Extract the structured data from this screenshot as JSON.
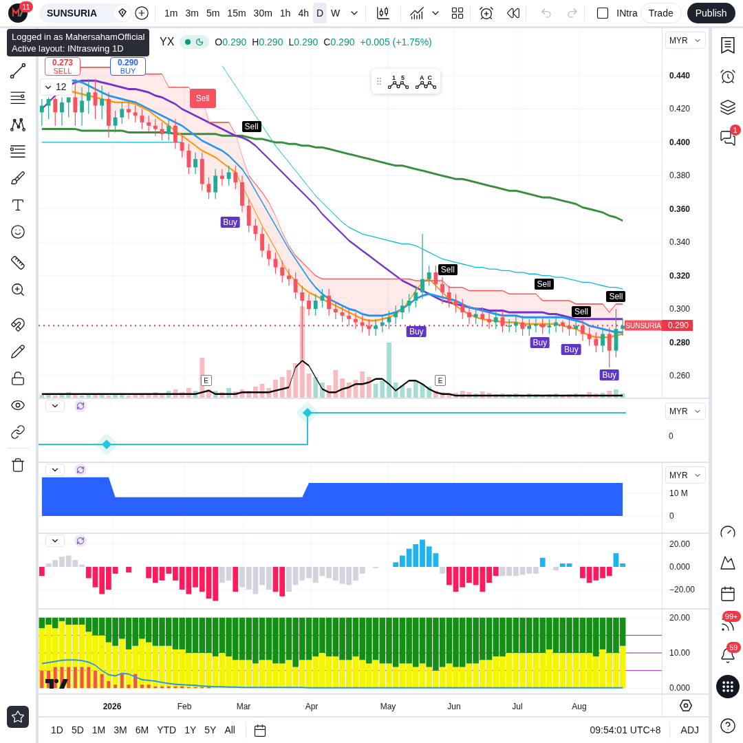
{
  "toolbar": {
    "avatar_badge": "11",
    "symbol": "SUNSURIA",
    "intervals": [
      {
        "label": "1m",
        "selected": false
      },
      {
        "label": "3m",
        "selected": false
      },
      {
        "label": "5m",
        "selected": false
      },
      {
        "label": "15m",
        "selected": false
      },
      {
        "label": "30m",
        "selected": false
      },
      {
        "label": "1h",
        "selected": false
      },
      {
        "label": "4h",
        "selected": false
      },
      {
        "label": "D",
        "selected": true
      },
      {
        "label": "W",
        "selected": false
      }
    ],
    "layout_name": "INtra",
    "trade_button": "Trade",
    "publish_button": "Publish",
    "undo_disabled": true,
    "redo_disabled": true
  },
  "tooltip": {
    "lines": [
      "Logged in as MahersahamOfficial",
      "Active layout: INtraswing 1D"
    ]
  },
  "legend": {
    "title": "YX",
    "values": [
      {
        "key": "O",
        "value": "0.290"
      },
      {
        "key": "H",
        "value": "0.290"
      },
      {
        "key": "L",
        "value": "0.290"
      },
      {
        "key": "C",
        "value": "0.290"
      }
    ],
    "change": "+0.005 (+1.75%)"
  },
  "order_buttons": [
    {
      "kind": "sell",
      "price": "0.273",
      "label": "SELL"
    },
    {
      "kind": "buy",
      "price": "0.290",
      "label": "BUY"
    }
  ],
  "indicator_toggle": {
    "count": "12"
  },
  "wave_tools": [
    {
      "labels": [
        "1",
        "5"
      ]
    },
    {
      "labels": [
        "A",
        "C"
      ]
    }
  ],
  "signals": [
    {
      "kind": "alert",
      "label": "Sell"
    },
    {
      "kind": "sell",
      "label": "Sell"
    },
    {
      "kind": "buy",
      "label": "Buy"
    },
    {
      "kind": "buy",
      "label": "Buy"
    },
    {
      "kind": "sell",
      "label": "Sell"
    },
    {
      "kind": "sell",
      "label": "Sell"
    },
    {
      "kind": "buy",
      "label": "Buy"
    },
    {
      "kind": "sell",
      "label": "Sell"
    },
    {
      "kind": "buy",
      "label": "Buy"
    },
    {
      "kind": "sell",
      "label": "Sell"
    },
    {
      "kind": "buy",
      "label": "Buy"
    },
    {
      "kind": "earnings",
      "label": "E"
    },
    {
      "kind": "earnings",
      "label": "E"
    }
  ],
  "price_marker": {
    "symbol": "SUNSURIA",
    "price": "0.290"
  },
  "panes": [
    {
      "kind": "price",
      "currency": "MYR",
      "chart_data": {
        "type": "candlestick",
        "grid": true,
        "ylim": [
          0.2468,
          0.4685
        ],
        "yticks": [
          {
            "value": 0.44,
            "label": "0.440"
          },
          {
            "value": 0.42,
            "label": "0.420"
          },
          {
            "value": 0.4,
            "label": "0.400"
          },
          {
            "value": 0.38,
            "label": "0.380"
          },
          {
            "value": 0.36,
            "label": "0.360"
          },
          {
            "value": 0.34,
            "label": "0.340"
          },
          {
            "value": 0.32,
            "label": "0.320"
          },
          {
            "value": 0.3,
            "label": "0.300"
          },
          {
            "value": 0.28,
            "label": "0.280"
          },
          {
            "value": 0.26,
            "label": "0.260"
          }
        ],
        "categories": [
          null,
          null,
          null,
          null,
          null,
          null,
          null,
          null,
          null,
          null,
          null,
          null,
          null,
          null,
          null,
          null,
          null,
          null,
          null,
          null,
          null,
          null,
          null,
          null,
          null,
          null,
          null,
          null,
          null,
          null,
          null,
          null,
          null,
          null,
          null,
          null,
          null,
          null,
          null,
          null,
          null,
          null,
          null,
          null,
          null,
          null,
          null,
          null,
          null,
          null,
          null,
          null,
          null,
          null,
          null,
          null,
          null,
          null,
          null,
          null,
          null,
          null,
          null,
          null,
          null,
          null,
          null,
          null,
          null,
          null,
          null,
          null,
          null,
          null,
          null,
          null,
          null,
          null,
          null,
          null,
          null,
          null,
          null,
          null,
          null,
          null,
          null,
          null
        ],
        "ohlc": [
          [
            0.418,
            0.426,
            0.41,
            0.422
          ],
          [
            0.422,
            0.427,
            0.414,
            0.426
          ],
          [
            0.426,
            0.427,
            0.41,
            0.418
          ],
          [
            0.418,
            0.427,
            0.41,
            0.424
          ],
          [
            0.424,
            0.427,
            0.415,
            0.427
          ],
          [
            0.427,
            0.438,
            0.41,
            0.418
          ],
          [
            0.418,
            0.433,
            0.41,
            0.425
          ],
          [
            0.425,
            0.438,
            0.417,
            0.43
          ],
          [
            0.43,
            0.438,
            0.414,
            0.422
          ],
          [
            0.422,
            0.434,
            0.414,
            0.426
          ],
          [
            0.426,
            0.43,
            0.403,
            0.41
          ],
          [
            0.41,
            0.419,
            0.406,
            0.415
          ],
          [
            0.415,
            0.424,
            0.411,
            0.42
          ],
          [
            0.42,
            0.424,
            0.414,
            0.418
          ],
          [
            0.418,
            0.422,
            0.412,
            0.416
          ],
          [
            0.416,
            0.42,
            0.408,
            0.412
          ],
          [
            0.412,
            0.416,
            0.406,
            0.41
          ],
          [
            0.41,
            0.414,
            0.404,
            0.408
          ],
          [
            0.408,
            0.412,
            0.401,
            0.405
          ],
          [
            0.405,
            0.414,
            0.401,
            0.41
          ],
          [
            0.41,
            0.414,
            0.396,
            0.4
          ],
          [
            0.4,
            0.404,
            0.391,
            0.395
          ],
          [
            0.395,
            0.399,
            0.381,
            0.385
          ],
          [
            0.385,
            0.394,
            0.381,
            0.39
          ],
          [
            0.39,
            0.394,
            0.371,
            0.375
          ],
          [
            0.375,
            0.379,
            0.366,
            0.37
          ],
          [
            0.37,
            0.384,
            0.366,
            0.38
          ],
          [
            0.38,
            0.384,
            0.374,
            0.378
          ],
          [
            0.378,
            0.386,
            0.374,
            0.382
          ],
          [
            0.382,
            0.386,
            0.372,
            0.376
          ],
          [
            0.376,
            0.38,
            0.358,
            0.362
          ],
          [
            0.362,
            0.366,
            0.346,
            0.35
          ],
          [
            0.35,
            0.354,
            0.341,
            0.345
          ],
          [
            0.345,
            0.349,
            0.331,
            0.335
          ],
          [
            0.335,
            0.339,
            0.326,
            0.33
          ],
          [
            0.33,
            0.334,
            0.321,
            0.325
          ],
          [
            0.325,
            0.329,
            0.316,
            0.32
          ],
          [
            0.32,
            0.324,
            0.314,
            0.318
          ],
          [
            0.318,
            0.322,
            0.306,
            0.31
          ],
          [
            0.31,
            0.314,
            0.27,
            0.305
          ],
          [
            0.305,
            0.309,
            0.296,
            0.3
          ],
          [
            0.3,
            0.309,
            0.296,
            0.305
          ],
          [
            0.305,
            0.312,
            0.301,
            0.308
          ],
          [
            0.308,
            0.312,
            0.296,
            0.3
          ],
          [
            0.3,
            0.304,
            0.294,
            0.298
          ],
          [
            0.298,
            0.302,
            0.292,
            0.296
          ],
          [
            0.296,
            0.3,
            0.29,
            0.294
          ],
          [
            0.294,
            0.298,
            0.288,
            0.292
          ],
          [
            0.292,
            0.296,
            0.286,
            0.29
          ],
          [
            0.29,
            0.294,
            0.284,
            0.288
          ],
          [
            0.288,
            0.294,
            0.284,
            0.29
          ],
          [
            0.29,
            0.296,
            0.286,
            0.292
          ],
          [
            0.292,
            0.299,
            0.288,
            0.295
          ],
          [
            0.295,
            0.302,
            0.291,
            0.298
          ],
          [
            0.298,
            0.306,
            0.294,
            0.302
          ],
          [
            0.302,
            0.309,
            0.298,
            0.305
          ],
          [
            0.305,
            0.314,
            0.301,
            0.31
          ],
          [
            0.31,
            0.345,
            0.306,
            0.318
          ],
          [
            0.318,
            0.326,
            0.314,
            0.322
          ],
          [
            0.322,
            0.326,
            0.311,
            0.315
          ],
          [
            0.315,
            0.319,
            0.303,
            0.31
          ],
          [
            0.31,
            0.314,
            0.301,
            0.305
          ],
          [
            0.305,
            0.309,
            0.298,
            0.302
          ],
          [
            0.302,
            0.306,
            0.294,
            0.298
          ],
          [
            0.298,
            0.302,
            0.291,
            0.295
          ],
          [
            0.295,
            0.301,
            0.291,
            0.297
          ],
          [
            0.297,
            0.301,
            0.29,
            0.294
          ],
          [
            0.294,
            0.298,
            0.288,
            0.292
          ],
          [
            0.292,
            0.299,
            0.288,
            0.295
          ],
          [
            0.295,
            0.299,
            0.286,
            0.29
          ],
          [
            0.29,
            0.294,
            0.286,
            0.29
          ],
          [
            0.29,
            0.296,
            0.286,
            0.292
          ],
          [
            0.292,
            0.296,
            0.284,
            0.288
          ],
          [
            0.288,
            0.294,
            0.284,
            0.29
          ],
          [
            0.29,
            0.295,
            0.286,
            0.291
          ],
          [
            0.291,
            0.295,
            0.285,
            0.289
          ],
          [
            0.289,
            0.294,
            0.285,
            0.29
          ],
          [
            0.29,
            0.296,
            0.286,
            0.292
          ],
          [
            0.292,
            0.293,
            0.286,
            0.29
          ],
          [
            0.29,
            0.294,
            0.284,
            0.288
          ],
          [
            0.288,
            0.294,
            0.284,
            0.29
          ],
          [
            0.29,
            0.294,
            0.281,
            0.285
          ],
          [
            0.285,
            0.289,
            0.278,
            0.282
          ],
          [
            0.282,
            0.286,
            0.274,
            0.278
          ],
          [
            0.278,
            0.289,
            0.274,
            0.285
          ],
          [
            0.285,
            0.289,
            0.265,
            0.275
          ],
          [
            0.275,
            0.3,
            0.271,
            0.288
          ],
          [
            0.288,
            0.294,
            0.284,
            0.29
          ]
        ]
      }
    },
    {
      "kind": "steps",
      "currency": "MYR",
      "tick": "0",
      "header_controls": true
    },
    {
      "kind": "area",
      "currency": "MYR",
      "header_controls": true,
      "chart_data": {
        "type": "area",
        "grid": true,
        "ylim": [
          -7.3,
          23.3
        ],
        "yticks": [
          {
            "value": 10,
            "label": "10 M"
          },
          {
            "value": 0,
            "label": "0"
          }
        ],
        "categories": [
          null,
          null,
          null,
          null,
          null,
          null,
          null,
          null,
          null,
          null,
          null,
          null,
          null,
          null,
          null,
          null,
          null,
          null,
          null,
          null,
          null,
          null,
          null,
          null,
          null,
          null,
          null,
          null,
          null,
          null,
          null,
          null,
          null,
          null,
          null,
          null,
          null,
          null,
          null,
          null,
          null,
          null,
          null,
          null,
          null,
          null,
          null,
          null,
          null,
          null,
          null,
          null,
          null,
          null,
          null,
          null,
          null,
          null,
          null,
          null,
          null,
          null,
          null,
          null,
          null,
          null,
          null,
          null,
          null,
          null,
          null,
          null,
          null,
          null,
          null,
          null,
          null,
          null,
          null,
          null,
          null,
          null,
          null,
          null,
          null,
          null,
          null,
          null
        ],
        "series": [
          {
            "color": "#2962ff",
            "values": [
              17,
              17,
              17,
              17,
              17,
              17,
              17,
              17,
              17,
              17,
              17,
              8.2,
              8.2,
              8.2,
              8.2,
              8.2,
              8.2,
              8.2,
              8.2,
              8.2,
              8.2,
              8.2,
              8.2,
              8.2,
              8.2,
              8.2,
              8.2,
              8.2,
              8.2,
              8.2,
              8.2,
              8.2,
              8.2,
              8.2,
              8.2,
              8.2,
              8.2,
              8.2,
              8.2,
              8.2,
              14.5,
              14.5,
              14.5,
              14.5,
              14.5,
              14.5,
              14.5,
              14.5,
              14.5,
              14.5,
              14.5,
              14.5,
              14.5,
              14.5,
              14.5,
              14.5,
              14.5,
              14.5,
              14.5,
              14.5,
              14.5,
              14.5,
              14.5,
              14.5,
              14.5,
              14.5,
              14.5,
              14.5,
              14.5,
              14.5,
              14.5,
              14.5,
              14.5,
              14.5,
              14.5,
              14.5,
              14.5,
              14.5,
              14.5,
              14.5,
              14.5,
              14.5,
              14.5,
              14.5,
              14.5,
              14.5,
              14.5,
              14.5
            ]
          }
        ]
      }
    },
    {
      "kind": "histogram",
      "header_controls": true,
      "chart_data": {
        "type": "bar",
        "grid": true,
        "ylim": [
          -36.4,
          29.1
        ],
        "yticks": [
          {
            "value": 20,
            "label": "20.00"
          },
          {
            "value": 0,
            "label": "0.000"
          },
          {
            "value": -20,
            "label": "−20.00"
          }
        ],
        "categories": [
          null,
          null,
          null,
          null,
          null,
          null,
          null,
          null,
          null,
          null,
          null,
          null,
          null,
          null,
          null,
          null,
          null,
          null,
          null,
          null,
          null,
          null,
          null,
          null,
          null,
          null,
          null,
          null,
          null,
          null,
          null,
          null,
          null,
          null,
          null,
          null,
          null,
          null,
          null,
          null,
          null,
          null,
          null,
          null,
          null,
          null,
          null,
          null,
          null,
          null,
          null,
          null,
          null,
          null,
          null,
          null,
          null,
          null,
          null,
          null,
          null,
          null,
          null,
          null,
          null,
          null,
          null,
          null,
          null,
          null,
          null,
          null,
          null,
          null,
          null,
          null,
          null,
          null,
          null,
          null,
          null,
          null,
          null,
          null,
          null,
          null,
          null,
          null
        ],
        "series": [
          {
            "color": "#d1d4dc",
            "values": [
              null,
              3,
              6,
              9,
              10,
              6,
              2,
              null,
              null,
              null,
              null,
              null,
              null,
              null,
              null,
              null,
              null,
              null,
              null,
              null,
              null,
              null,
              null,
              null,
              null,
              null,
              null,
              -14,
              -12,
              null,
              -18,
              -20,
              -24,
              -16,
              -20,
              null,
              null,
              -22,
              -16,
              -12,
              -10,
              -14,
              -8,
              -10,
              -12,
              -15,
              -16,
              -12,
              -6,
              null,
              -1,
              null,
              null,
              null,
              null,
              null,
              null,
              null,
              null,
              null,
              -6,
              null,
              null,
              null,
              null,
              null,
              null,
              null,
              null,
              -8,
              -8,
              -8,
              -7,
              -6,
              -6,
              null,
              null,
              -3,
              null,
              null,
              null,
              null,
              null,
              null,
              null,
              null,
              null,
              null
            ]
          },
          {
            "color": "#ff1a5e",
            "values": [
              -8,
              null,
              null,
              null,
              null,
              null,
              null,
              -10,
              -18,
              -24,
              -20,
              -6,
              null,
              -5,
              null,
              null,
              -10,
              -14,
              -12,
              -6,
              -12,
              -20,
              -24,
              -18,
              -22,
              -28,
              -30,
              null,
              null,
              -22,
              null,
              null,
              null,
              null,
              null,
              -22,
              -26,
              null,
              null,
              null,
              null,
              null,
              null,
              null,
              null,
              null,
              null,
              null,
              null,
              null,
              null,
              null,
              null,
              null,
              null,
              null,
              null,
              null,
              null,
              null,
              null,
              -16,
              -22,
              -18,
              -14,
              -16,
              -22,
              -14,
              -8,
              null,
              null,
              null,
              null,
              null,
              null,
              null,
              null,
              null,
              null,
              null,
              null,
              -10,
              -14,
              -12,
              -10,
              -8,
              null,
              null
            ]
          },
          {
            "color": "#1eb4f0",
            "values": [
              null,
              null,
              null,
              null,
              null,
              null,
              null,
              null,
              null,
              null,
              null,
              null,
              null,
              null,
              null,
              null,
              null,
              null,
              null,
              null,
              null,
              null,
              null,
              null,
              null,
              null,
              null,
              null,
              null,
              null,
              null,
              null,
              null,
              null,
              null,
              null,
              null,
              null,
              null,
              null,
              null,
              null,
              null,
              null,
              null,
              null,
              null,
              null,
              null,
              null,
              null,
              null,
              null,
              4,
              10,
              16,
              20,
              24,
              18,
              12,
              null,
              null,
              null,
              null,
              null,
              null,
              null,
              null,
              null,
              null,
              null,
              null,
              null,
              null,
              null,
              8,
              null,
              null,
              3,
              3,
              null,
              null,
              null,
              null,
              null,
              null,
              12,
              3
            ]
          }
        ]
      }
    },
    {
      "kind": "stacked",
      "chart_data": {
        "type": "bar",
        "stacked": true,
        "grid": true,
        "ylim": [
          -1.5,
          22.3
        ],
        "yticks": [
          {
            "value": 20,
            "label": "20.00"
          },
          {
            "value": 10,
            "label": "10.00"
          },
          {
            "value": 0,
            "label": "0.000"
          }
        ],
        "categories": [
          null,
          null,
          null,
          null,
          null,
          null,
          null,
          null,
          null,
          null,
          null,
          null,
          null,
          null,
          null,
          null,
          null,
          null,
          null,
          null,
          null,
          null,
          null,
          null,
          null,
          null,
          null,
          null,
          null,
          null,
          null,
          null,
          null,
          null,
          null,
          null,
          null,
          null,
          null,
          null,
          null,
          null,
          null,
          null,
          null,
          null,
          null,
          null,
          null,
          null,
          null,
          null,
          null,
          null,
          null,
          null,
          null,
          null,
          null,
          null,
          null,
          null,
          null,
          null,
          null,
          null,
          null,
          null,
          null,
          null,
          null,
          null,
          null,
          null,
          null,
          null,
          null,
          null,
          null,
          null,
          null,
          null,
          null,
          null,
          null,
          null,
          null,
          null
        ],
        "series": [
          {
            "color": "#f5f500",
            "values": [
              17,
              18,
              17,
              19,
              18,
              18,
              18,
              16,
              15,
              15,
              13,
              12,
              14,
              11,
              12,
              14,
              13,
              12,
              12,
              12,
              11,
              11,
              10,
              10,
              10,
              10,
              9,
              10,
              9,
              8,
              8,
              8,
              7,
              8,
              8,
              7,
              7,
              8,
              6,
              8,
              8,
              9,
              10,
              9,
              9,
              8,
              8,
              9,
              8,
              7,
              8,
              7,
              7,
              6,
              7,
              7,
              6,
              7,
              6,
              5,
              6,
              7,
              6,
              6,
              7,
              7,
              8,
              8,
              9,
              9,
              10,
              10,
              10,
              10,
              10,
              10,
              11,
              10,
              10,
              10,
              10,
              10,
              10,
              9,
              11,
              10,
              10,
              12
            ]
          },
          {
            "color": "#138f13",
            "values": [
              3,
              2,
              3,
              1,
              2,
              2,
              2,
              4,
              5,
              5,
              7,
              8,
              6,
              9,
              8,
              6,
              7,
              8,
              8,
              8,
              9,
              9,
              10,
              10,
              10,
              10,
              11,
              10,
              11,
              12,
              12,
              12,
              13,
              12,
              12,
              13,
              13,
              12,
              14,
              12,
              12,
              11,
              10,
              11,
              11,
              12,
              12,
              11,
              12,
              13,
              12,
              13,
              13,
              14,
              13,
              13,
              14,
              13,
              14,
              15,
              14,
              13,
              14,
              14,
              13,
              13,
              12,
              12,
              11,
              11,
              10,
              10,
              10,
              10,
              10,
              10,
              9,
              10,
              10,
              10,
              10,
              10,
              10,
              11,
              9,
              10,
              10,
              8
            ]
          }
        ]
      }
    }
  ],
  "time_axis": {
    "labels": [
      {
        "text": "2026",
        "bold": true
      },
      {
        "text": "Feb",
        "bold": false
      },
      {
        "text": "Mar",
        "bold": false
      },
      {
        "text": "Apr",
        "bold": false
      },
      {
        "text": "May",
        "bold": false
      },
      {
        "text": "Jun",
        "bold": false
      },
      {
        "text": "Jul",
        "bold": false
      },
      {
        "text": "Aug",
        "bold": false
      }
    ]
  },
  "bottom_bar": {
    "ranges": [
      "1D",
      "5D",
      "1M",
      "3M",
      "6M",
      "YTD",
      "1Y",
      "5Y",
      "All"
    ],
    "clock": "09:54:01 UTC+8",
    "adjust": "ADJ"
  },
  "right_sidebar": {
    "chat_badge": "1",
    "feed_badge": "99+",
    "alerts_badge": "59"
  }
}
